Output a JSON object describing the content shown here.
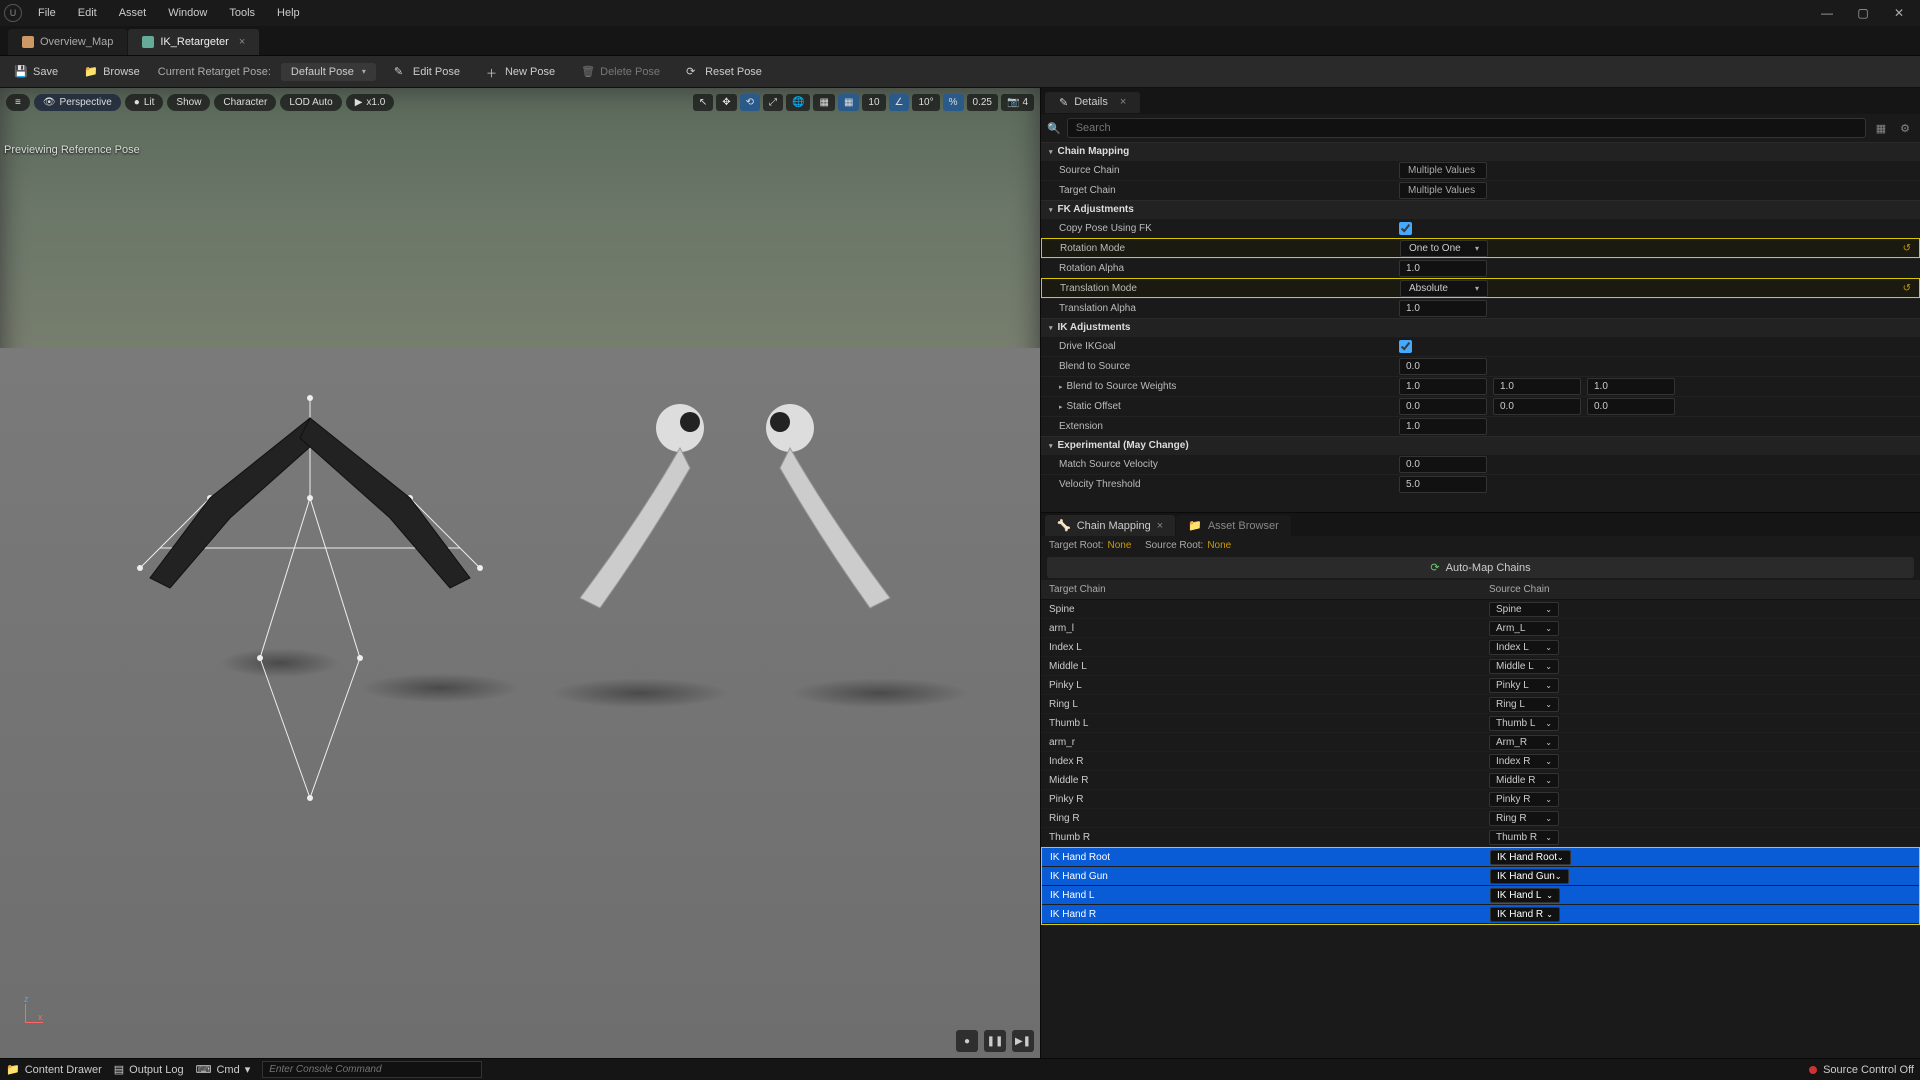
{
  "menu": {
    "file": "File",
    "edit": "Edit",
    "asset": "Asset",
    "window": "Window",
    "tools": "Tools",
    "help": "Help"
  },
  "tabs": {
    "overview": "Overview_Map",
    "retargeter": "IK_Retargeter"
  },
  "toolbar": {
    "save": "Save",
    "browse": "Browse",
    "current": "Current Retarget Pose:",
    "default": "Default Pose",
    "edit": "Edit Pose",
    "new": "New Pose",
    "delete": "Delete Pose",
    "reset": "Reset Pose"
  },
  "viewport": {
    "menu": "≡",
    "perspective": "Perspective",
    "lit": "Lit",
    "show": "Show",
    "character": "Character",
    "lod": "LOD Auto",
    "speed": "x1.0",
    "preview_label": "Previewing Reference Pose",
    "snap10": "10",
    "snap_deg": "10°",
    "snap_scale": "0.25",
    "cam": "4"
  },
  "details": {
    "tab": "Details",
    "search_ph": "Search",
    "sections": {
      "chain": "Chain Mapping",
      "fk": "FK Adjustments",
      "ik": "IK Adjustments",
      "exp": "Experimental (May Change)"
    },
    "props": {
      "source_chain": "Source Chain",
      "source_chain_v": "Multiple Values",
      "target_chain": "Target Chain",
      "target_chain_v": "Multiple Values",
      "copy_pose": "Copy Pose Using FK",
      "rot_mode": "Rotation Mode",
      "rot_mode_v": "One to One",
      "rot_alpha": "Rotation Alpha",
      "rot_alpha_v": "1.0",
      "trans_mode": "Translation Mode",
      "trans_mode_v": "Absolute",
      "trans_alpha": "Translation Alpha",
      "trans_alpha_v": "1.0",
      "drive": "Drive IKGoal",
      "blend_src": "Blend to Source",
      "blend_src_v": "0.0",
      "blend_w": "Blend to Source Weights",
      "bw1": "1.0",
      "bw2": "1.0",
      "bw3": "1.0",
      "static_off": "Static Offset",
      "so1": "0.0",
      "so2": "0.0",
      "so3": "0.0",
      "extension": "Extension",
      "extension_v": "1.0",
      "match_vel": "Match Source Velocity",
      "match_vel_v": "0.0",
      "vel_thresh": "Velocity Threshold",
      "vel_thresh_v": "5.0"
    }
  },
  "chainmap": {
    "tab1": "Chain Mapping",
    "tab2": "Asset Browser",
    "target_root": "Target Root:",
    "source_root": "Source Root:",
    "none": "None",
    "automap": "Auto-Map Chains",
    "header_t": "Target Chain",
    "header_s": "Source Chain",
    "rows": [
      {
        "t": "Spine",
        "s": "Spine"
      },
      {
        "t": "arm_l",
        "s": "Arm_L"
      },
      {
        "t": "Index L",
        "s": "Index L"
      },
      {
        "t": "Middle L",
        "s": "Middle L"
      },
      {
        "t": "Pinky L",
        "s": "Pinky L"
      },
      {
        "t": "Ring L",
        "s": "Ring L"
      },
      {
        "t": "Thumb L",
        "s": "Thumb L"
      },
      {
        "t": "arm_r",
        "s": "Arm_R"
      },
      {
        "t": "Index R",
        "s": "Index R"
      },
      {
        "t": "Middle R",
        "s": "Middle R"
      },
      {
        "t": "Pinky R",
        "s": "Pinky R"
      },
      {
        "t": "Ring R",
        "s": "Ring R"
      },
      {
        "t": "Thumb R",
        "s": "Thumb R"
      },
      {
        "t": "IK Hand Root",
        "s": "IK Hand Root",
        "sel": true
      },
      {
        "t": "IK Hand Gun",
        "s": "IK Hand Gun",
        "sel": true
      },
      {
        "t": "IK Hand L",
        "s": "IK Hand L",
        "sel": true
      },
      {
        "t": "IK Hand R",
        "s": "IK Hand R",
        "sel": true
      }
    ]
  },
  "status": {
    "drawer": "Content Drawer",
    "output": "Output Log",
    "cmd": "Cmd",
    "cmd_ph": "Enter Console Command",
    "src_ctrl": "Source Control Off"
  }
}
